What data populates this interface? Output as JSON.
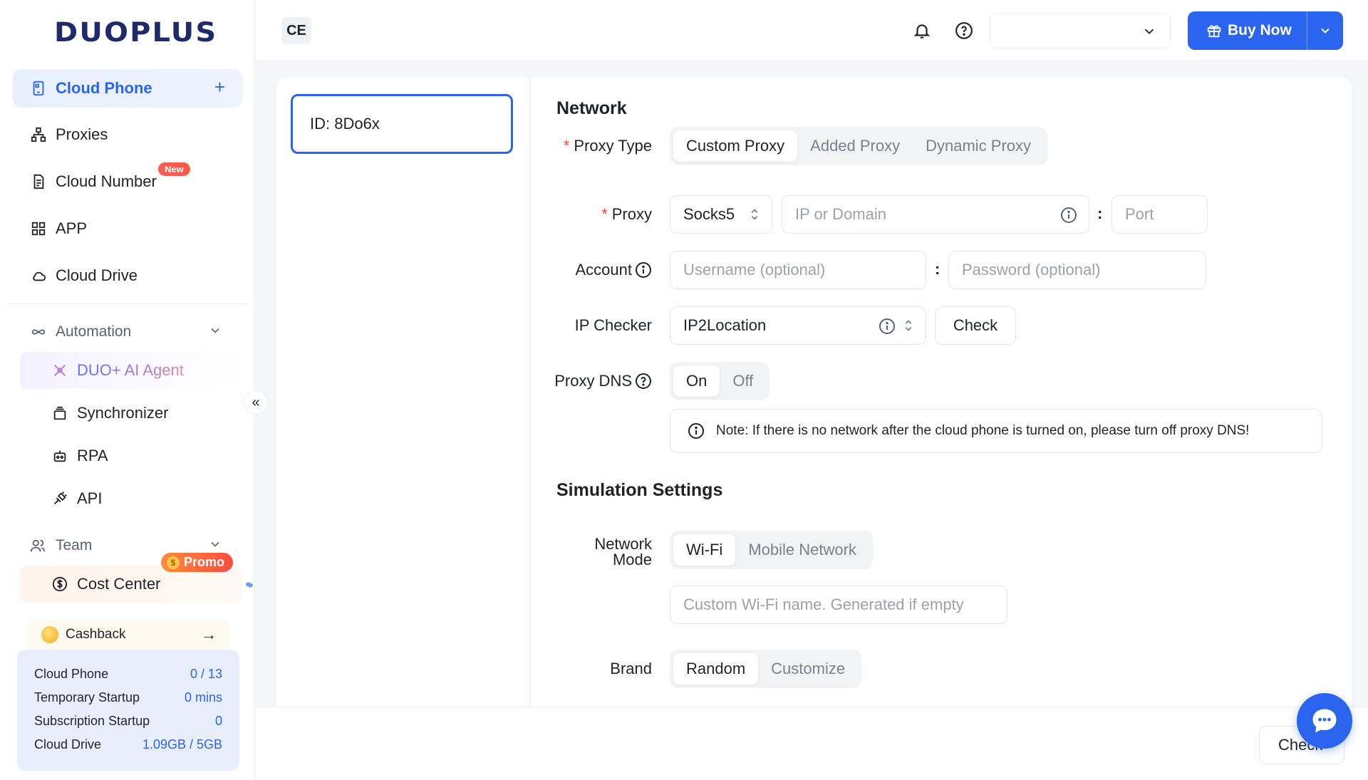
{
  "brand": {
    "logo_text": "DUOPLUS"
  },
  "sidebar": {
    "items": [
      {
        "label": "Cloud Phone",
        "icon": "phone-icon",
        "active": true
      },
      {
        "label": "Proxies",
        "icon": "network-icon"
      },
      {
        "label": "Cloud Number",
        "icon": "sim-card-icon",
        "badge": "New"
      },
      {
        "label": "APP",
        "icon": "grid-icon"
      },
      {
        "label": "Cloud Drive",
        "icon": "cloud-icon"
      }
    ],
    "automation": {
      "label": "Automation",
      "items": [
        {
          "label": "DUO+ AI Agent",
          "icon": "ai-icon"
        },
        {
          "label": "Synchronizer",
          "icon": "stack-icon"
        },
        {
          "label": "RPA",
          "icon": "robot-icon"
        },
        {
          "label": "API",
          "icon": "plug-icon"
        }
      ]
    },
    "team": {
      "label": "Team",
      "items": [
        {
          "label": "Cost Center",
          "icon": "dollar-icon",
          "badge": "Promo"
        }
      ]
    },
    "cashback": {
      "label": "Cashback",
      "arrow": "→"
    },
    "usage": [
      {
        "label": "Cloud Phone",
        "value": "0 / 13"
      },
      {
        "label": "Temporary Startup",
        "value": "0 mins"
      },
      {
        "label": "Subscription Startup",
        "value": "0"
      },
      {
        "label": "Cloud Drive",
        "value": "1.09GB / 5GB"
      }
    ],
    "collapse_glyph": "«"
  },
  "header": {
    "tab_label": "CE",
    "account_value": "",
    "buy_label": "Buy Now"
  },
  "device": {
    "id_label": "ID: 8Do6x"
  },
  "form": {
    "network_title": "Network",
    "proxy_type": {
      "label": "Proxy Type",
      "options": [
        "Custom Proxy",
        "Added Proxy",
        "Dynamic Proxy"
      ],
      "selected": "Custom Proxy"
    },
    "proxy": {
      "label": "Proxy",
      "protocol": "Socks5",
      "host_placeholder": "IP or Domain",
      "port_placeholder": "Port",
      "colon": ":"
    },
    "account": {
      "label": "Account",
      "username_placeholder": "Username (optional)",
      "password_placeholder": "Password (optional)",
      "colon": ":"
    },
    "ip_checker": {
      "label": "IP Checker",
      "value": "IP2Location",
      "check_label": "Check"
    },
    "proxy_dns": {
      "label": "Proxy DNS",
      "options": [
        "On",
        "Off"
      ],
      "selected": "On"
    },
    "note": "Note: If there is no network after the cloud phone is turned on, please turn off proxy DNS!",
    "simulation_title": "Simulation Settings",
    "network_mode": {
      "label_line1": "Network",
      "label_line2": "Mode",
      "options": [
        "Wi-Fi",
        "Mobile Network"
      ],
      "selected": "Wi-Fi",
      "wifi_placeholder": "Custom Wi-Fi name. Generated if empty"
    },
    "brand": {
      "label": "Brand",
      "options": [
        "Random",
        "Customize"
      ],
      "selected": "Random"
    }
  },
  "footer": {
    "check_label": "Check"
  },
  "colors": {
    "primary": "#2b64ef",
    "required": "#f0453a",
    "badge": "#ff5b4d"
  }
}
